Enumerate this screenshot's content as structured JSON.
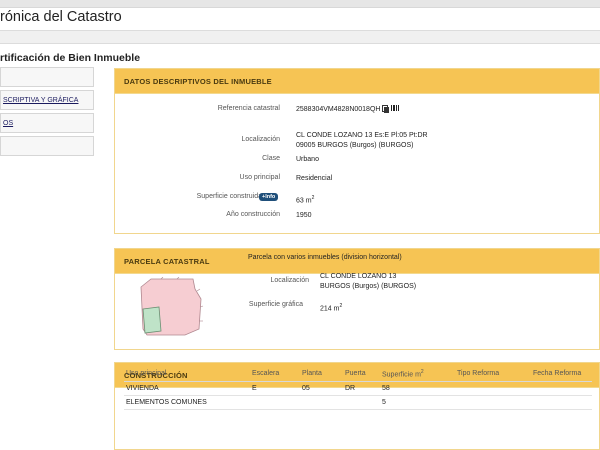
{
  "header": {
    "app_title": "rónica del Catastro"
  },
  "page": {
    "heading": "rtificación de Bien Inmueble"
  },
  "sidebar": {
    "items": [
      {
        "label": ""
      },
      {
        "label": "SCRIPTIVA Y GRÁFICA"
      },
      {
        "label": "OS"
      },
      {
        "label": ""
      }
    ]
  },
  "datos": {
    "title": "DATOS DESCRIPTIVOS DEL INMUEBLE",
    "fields": [
      {
        "label": "Referencia catastral",
        "value": "2588304VM4828N0018QH"
      },
      {
        "label": "Localización",
        "value_line1": "CL CONDE LOZANO 13 Es:E Pl:05 Pt:DR",
        "value_line2": "09005 BURGOS (Burgos) (BURGOS)"
      },
      {
        "label": "Clase",
        "value": "Urbano"
      },
      {
        "label": "Uso principal",
        "value": "Residencial"
      },
      {
        "label": "Superficie construida",
        "badge": "+Info",
        "value": "63 m",
        "unit_sup": "2"
      },
      {
        "label": "Año construcción",
        "value": "1950"
      }
    ]
  },
  "parcela": {
    "title": "PARCELA CATASTRAL",
    "description": "Parcela con varios inmuebles (division horizontal)",
    "localizacion_label": "Localización",
    "localizacion_line1": "CL CONDE LOZANO 13",
    "localizacion_line2": "BURGOS (Burgos) (BURGOS)",
    "superficie_label": "Superficie gráfica",
    "superficie_value": "214 m",
    "superficie_sup": "2"
  },
  "construccion": {
    "title": "CONSTRUCCIÓN",
    "columns": [
      "Uso principal",
      "Escalera",
      "Planta",
      "Puerta",
      "Superficie m",
      "Tipo Reforma",
      "Fecha Reforma"
    ],
    "superficie_sup": "2",
    "rows": [
      [
        "VIVIENDA",
        "E",
        "05",
        "DR",
        "58",
        "",
        ""
      ],
      [
        "ELEMENTOS COMUNES",
        "",
        "",
        "",
        "5",
        "",
        ""
      ]
    ]
  },
  "colors": {
    "panel_header": "#f6c454",
    "panel_border": "#f1d68d",
    "parcel_fill": "#f6cdd2",
    "unit_fill": "#bfe3c8",
    "info_badge": "#1f4f7a"
  }
}
